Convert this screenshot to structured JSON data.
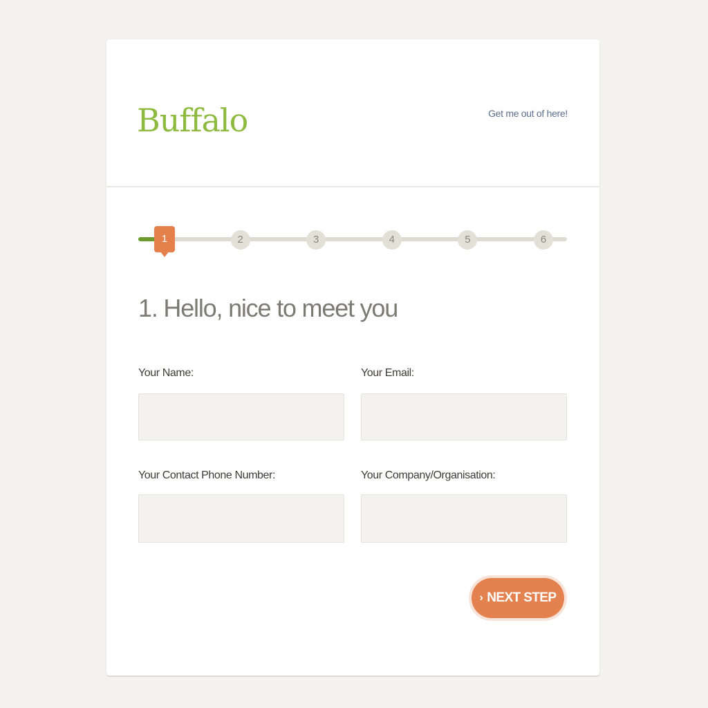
{
  "header": {
    "logo": "Buffalo",
    "exit_link": "Get me out of here!"
  },
  "progress": {
    "current_step": 1,
    "total_steps": 6,
    "fill_fraction": 0.06,
    "steps": [
      "1",
      "2",
      "3",
      "4",
      "5",
      "6"
    ]
  },
  "form": {
    "title": "1. Hello, nice to meet you",
    "fields": {
      "name": {
        "label": "Your Name:",
        "value": ""
      },
      "email": {
        "label": "Your Email:",
        "value": ""
      },
      "phone": {
        "label": "Your Contact Phone Number:",
        "value": ""
      },
      "company": {
        "label": "Your Company/Organisation:",
        "value": ""
      }
    },
    "next_button": {
      "icon": "chevron-right-icon",
      "label": "NEXT STEP"
    }
  },
  "colors": {
    "brand_green": "#8dba3f",
    "progress_green": "#6c9a2d",
    "accent_orange": "#e3814f",
    "input_bg": "#f3f2ee"
  }
}
